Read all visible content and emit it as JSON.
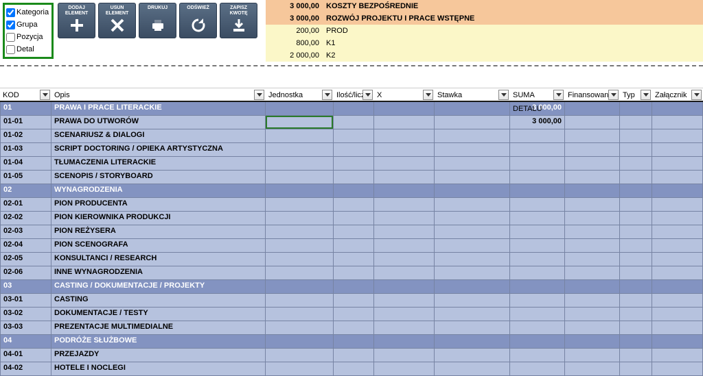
{
  "checkboxes": {
    "kategoria": {
      "label": "Kategoria",
      "checked": true
    },
    "grupa": {
      "label": "Grupa",
      "checked": true
    },
    "pozycja": {
      "label": "Pozycja",
      "checked": false
    },
    "detal": {
      "label": "Detal",
      "checked": false
    }
  },
  "toolbar": {
    "add": {
      "line1": "DODAJ",
      "line2": "ELEMENT"
    },
    "del": {
      "line1": "USUN",
      "line2": "ELEMENT"
    },
    "print": {
      "line1": "DRUKUJ",
      "line2": ""
    },
    "refresh": {
      "line1": "ODŚWIEŻ",
      "line2": ""
    },
    "save": {
      "line1": "ZAPISZ",
      "line2": "KWOTĘ"
    }
  },
  "summary": [
    {
      "amount": "3 000,00",
      "desc": "KOSZTY BEZPOŚREDNIE",
      "style": "orange"
    },
    {
      "amount": "3 000,00",
      "desc": "ROZWÓJ PROJEKTU I PRACE WSTĘPNE",
      "style": "orange"
    },
    {
      "amount": "200,00",
      "desc": "PROD",
      "style": "yellow"
    },
    {
      "amount": "800,00",
      "desc": "K1",
      "style": "yellow"
    },
    {
      "amount": "2 000,00",
      "desc": "K2",
      "style": "yellow"
    }
  ],
  "columns": {
    "kod": "KOD",
    "opis": "Opis",
    "jednostka": "Jednostka",
    "ilosc": "Ilość/licz",
    "x": "X",
    "stawka": "Stawka",
    "suma": "SUMA DETALU",
    "finans": "Finansowani",
    "typ": "Typ",
    "zal": "Załącznik"
  },
  "rows": [
    {
      "type": "cat",
      "kod": "01",
      "opis": "PRAWA I PRACE LITERACKIE",
      "suma": "3 000,00"
    },
    {
      "type": "grp",
      "kod": "01-01",
      "opis": "PRAWA DO UTWORÓW",
      "suma": "3 000,00",
      "active": true
    },
    {
      "type": "grp",
      "kod": "01-02",
      "opis": "SCENARIUSZ & DIALOGI",
      "suma": ""
    },
    {
      "type": "grp",
      "kod": "01-03",
      "opis": "SCRIPT DOCTORING / OPIEKA ARTYSTYCZNA",
      "suma": ""
    },
    {
      "type": "grp",
      "kod": "01-04",
      "opis": "TŁUMACZENIA LITERACKIE",
      "suma": ""
    },
    {
      "type": "grp",
      "kod": "01-05",
      "opis": "SCENOPIS / STORYBOARD",
      "suma": ""
    },
    {
      "type": "cat",
      "kod": "02",
      "opis": "WYNAGRODZENIA",
      "suma": ""
    },
    {
      "type": "grp",
      "kod": "02-01",
      "opis": "PION PRODUCENTA",
      "suma": ""
    },
    {
      "type": "grp",
      "kod": "02-02",
      "opis": "PION KIEROWNIKA PRODUKCJI",
      "suma": ""
    },
    {
      "type": "grp",
      "kod": "02-03",
      "opis": "PION REŻYSERA",
      "suma": ""
    },
    {
      "type": "grp",
      "kod": "02-04",
      "opis": "PION SCENOGRAFA",
      "suma": ""
    },
    {
      "type": "grp",
      "kod": "02-05",
      "opis": "KONSULTANCI / RESEARCH",
      "suma": ""
    },
    {
      "type": "grp",
      "kod": "02-06",
      "opis": "INNE WYNAGRODZENIA",
      "suma": ""
    },
    {
      "type": "cat",
      "kod": "03",
      "opis": "CASTING / DOKUMENTACJE / PROJEKTY",
      "suma": ""
    },
    {
      "type": "grp",
      "kod": "03-01",
      "opis": "CASTING",
      "suma": ""
    },
    {
      "type": "grp",
      "kod": "03-02",
      "opis": "DOKUMENTACJE / TESTY",
      "suma": ""
    },
    {
      "type": "grp",
      "kod": "03-03",
      "opis": "PREZENTACJE MULTIMEDIALNE",
      "suma": ""
    },
    {
      "type": "cat",
      "kod": "04",
      "opis": "PODRÓŻE SŁUŻBOWE",
      "suma": ""
    },
    {
      "type": "grp",
      "kod": "04-01",
      "opis": "PRZEJAZDY",
      "suma": ""
    },
    {
      "type": "grp",
      "kod": "04-02",
      "opis": "HOTELE I NOCLEGI",
      "suma": ""
    }
  ]
}
